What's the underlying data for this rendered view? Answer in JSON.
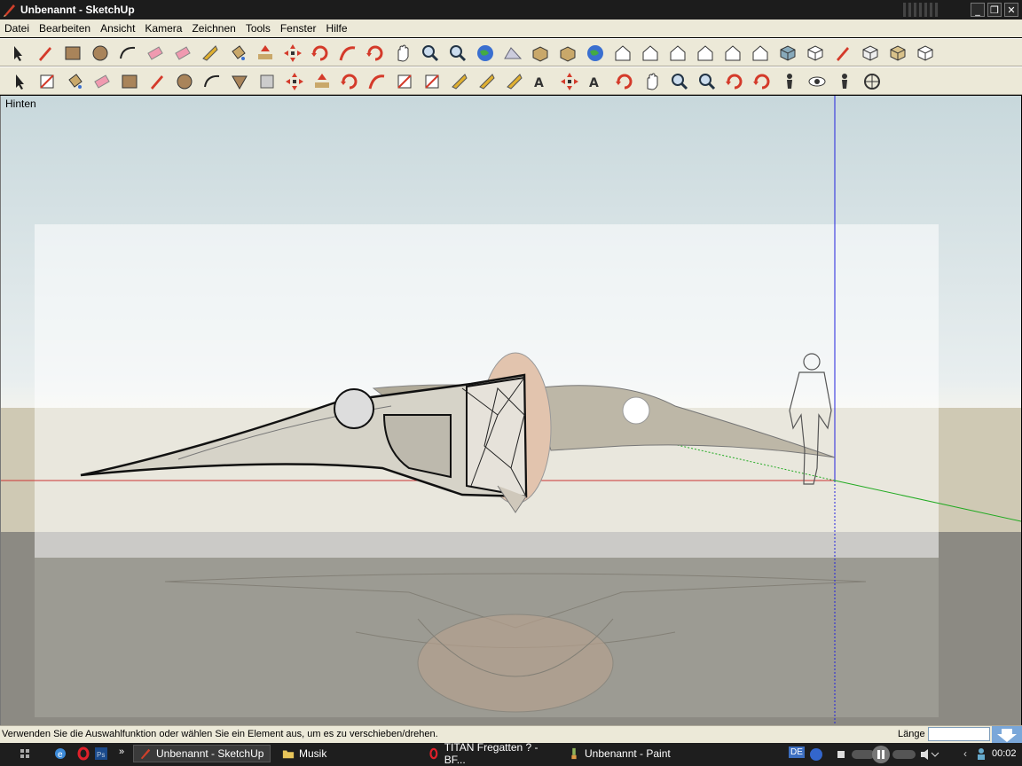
{
  "window": {
    "title": "Unbenannt - SketchUp"
  },
  "menu": [
    "Datei",
    "Bearbeiten",
    "Ansicht",
    "Kamera",
    "Zeichnen",
    "Tools",
    "Fenster",
    "Hilfe"
  ],
  "viewport": {
    "view_name": "Hinten"
  },
  "toolbar_row1": [
    "select-icon",
    "pencil-icon",
    "rectangle-icon",
    "circle-icon",
    "arc-icon",
    "eraser-icon",
    "eraser-pink-icon",
    "tape-measure-icon",
    "paint-bucket-icon",
    "push-pull-icon",
    "move-icon",
    "rotate-icon",
    "follow-me-icon",
    "orbit-icon",
    "pan-icon",
    "zoom-icon",
    "zoom-extents-icon",
    "google-earth-icon",
    "toggle-terrain-icon",
    "place-model-icon",
    "get-models-icon",
    "share-model-icon",
    "iso-view-icon",
    "front-view-icon",
    "top-view-icon",
    "right-view-icon",
    "back-view-icon",
    "left-view-icon",
    "xray-icon",
    "wireframe-icon",
    "hidden-line-icon",
    "shaded-icon",
    "shaded-texture-icon",
    "monochrome-icon"
  ],
  "toolbar_row2": [
    "select-icon",
    "make-component-icon",
    "paint-bucket-icon",
    "eraser-icon",
    "rectangle-icon",
    "line-icon",
    "circle-icon",
    "arc-icon",
    "polygon-icon",
    "freehand-icon",
    "move-icon",
    "push-pull-icon",
    "rotate-icon",
    "follow-me-icon",
    "scale-icon",
    "offset-icon",
    "tape-measure-icon",
    "dimension-icon",
    "protractor-icon",
    "text-icon",
    "axes-icon",
    "3d-text-icon",
    "orbit-icon",
    "pan-icon",
    "zoom-icon",
    "zoom-window-icon",
    "previous-view-icon",
    "next-view-icon",
    "position-camera-icon",
    "look-around-icon",
    "walk-icon",
    "section-plane-icon"
  ],
  "status": {
    "message": "Verwenden Sie die Auswahlfunktion oder wählen Sie ein Element aus, um es zu verschieben/drehen.",
    "length_label": "Länge",
    "length_value": ""
  },
  "taskbar": {
    "tasks": [
      {
        "label": "Unbenannt - SketchUp",
        "active": true
      },
      {
        "label": "Musik",
        "active": false
      },
      {
        "label": "TITAN Fregatten ? - BF...",
        "active": false
      },
      {
        "label": "Unbenannt - Paint",
        "active": false
      }
    ],
    "language": "DE",
    "clock": "00:02"
  },
  "colors": {
    "accent": "#7aa7d9",
    "axis_red": "#cc3333",
    "axis_green": "#22aa22",
    "axis_blue": "#2222dd"
  }
}
